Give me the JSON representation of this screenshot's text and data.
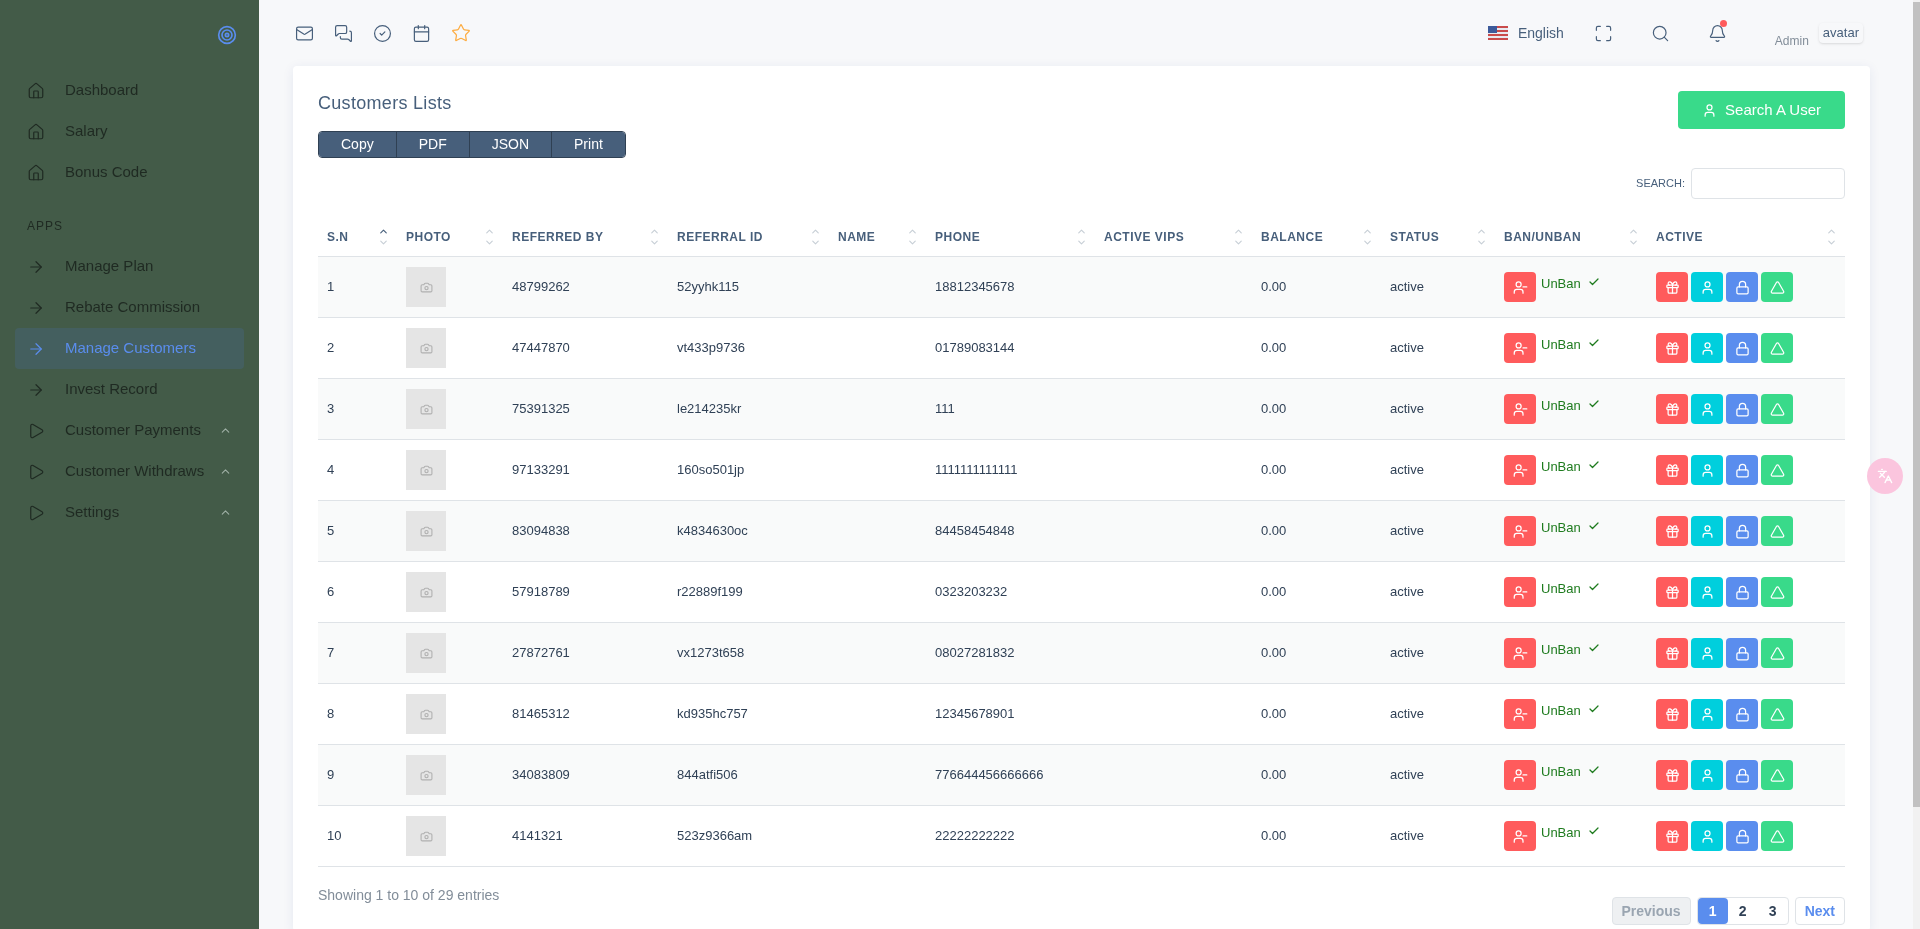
{
  "sidebar": {
    "main_items": [
      {
        "label": "Dashboard",
        "kind": "home",
        "selected": false,
        "has_submenu": false
      },
      {
        "label": "Salary",
        "kind": "home",
        "selected": false,
        "has_submenu": false
      },
      {
        "label": "Bonus Code",
        "kind": "home",
        "selected": false,
        "has_submenu": false
      }
    ],
    "section": {
      "title": "APPS",
      "items": [
        {
          "label": "Manage Plan",
          "kind": "link",
          "selected": false,
          "has_submenu": false
        },
        {
          "label": "Rebate Commission",
          "kind": "link",
          "selected": false,
          "has_submenu": false
        },
        {
          "label": "Manage Customers",
          "kind": "link",
          "selected": true,
          "has_submenu": false
        },
        {
          "label": "Invest Record",
          "kind": "link",
          "selected": false,
          "has_submenu": false
        },
        {
          "label": "Customer Payments",
          "kind": "menu",
          "selected": false,
          "has_submenu": true
        },
        {
          "label": "Customer Withdraws",
          "kind": "menu",
          "selected": false,
          "has_submenu": true
        },
        {
          "label": "Settings",
          "kind": "menu",
          "selected": false,
          "has_submenu": true
        }
      ]
    }
  },
  "topbar": {
    "language": "English",
    "notification_unread": true,
    "user": "Admin",
    "avatar_alt": "avatar"
  },
  "card": {
    "title": "Customers Lists",
    "export_buttons": [
      "Copy",
      "PDF",
      "JSON",
      "Print"
    ],
    "search_user_button": "Search A User",
    "search_label": "SEARCH:"
  },
  "table": {
    "columns": [
      {
        "label": "S.N",
        "sorted": true
      },
      {
        "label": "PHOTO",
        "sorted": false
      },
      {
        "label": "REFERRED BY",
        "sorted": false
      },
      {
        "label": "REFERRAL ID",
        "sorted": false
      },
      {
        "label": "NAME",
        "sorted": false
      },
      {
        "label": "PHONE",
        "sorted": false
      },
      {
        "label": "ACTIVE VIPS",
        "sorted": false
      },
      {
        "label": "BALANCE",
        "sorted": false
      },
      {
        "label": "STATUS",
        "sorted": false
      },
      {
        "label": "BAN/UNBAN",
        "sorted": false
      },
      {
        "label": "ACTIVE",
        "sorted": false
      }
    ],
    "rows": [
      {
        "sn": "1",
        "referred_by": "48799262",
        "referral_id": "52yyhk115",
        "phone": "18812345678",
        "balance": "0.00",
        "status": "active",
        "ban_label": "UnBan"
      },
      {
        "sn": "2",
        "referred_by": "47447870",
        "referral_id": "vt433p9736",
        "phone": "01789083144",
        "balance": "0.00",
        "status": "active",
        "ban_label": "UnBan"
      },
      {
        "sn": "3",
        "referred_by": "75391325",
        "referral_id": "le214235kr",
        "phone": "111",
        "balance": "0.00",
        "status": "active",
        "ban_label": "UnBan"
      },
      {
        "sn": "4",
        "referred_by": "97133291",
        "referral_id": "160so501jp",
        "phone": "1111111111111",
        "balance": "0.00",
        "status": "active",
        "ban_label": "UnBan"
      },
      {
        "sn": "5",
        "referred_by": "83094838",
        "referral_id": "k4834630oc",
        "phone": "84458454848",
        "balance": "0.00",
        "status": "active",
        "ban_label": "UnBan"
      },
      {
        "sn": "6",
        "referred_by": "57918789",
        "referral_id": "r22889f199",
        "phone": "0323203232",
        "balance": "0.00",
        "status": "active",
        "ban_label": "UnBan"
      },
      {
        "sn": "7",
        "referred_by": "27872761",
        "referral_id": "vx1273t658",
        "phone": "08027281832",
        "balance": "0.00",
        "status": "active",
        "ban_label": "UnBan"
      },
      {
        "sn": "8",
        "referred_by": "81465312",
        "referral_id": "kd935hc757",
        "phone": "12345678901",
        "balance": "0.00",
        "status": "active",
        "ban_label": "UnBan"
      },
      {
        "sn": "9",
        "referred_by": "34083809",
        "referral_id": "844atfi506",
        "phone": "776644456666666",
        "balance": "0.00",
        "status": "active",
        "ban_label": "UnBan"
      },
      {
        "sn": "10",
        "referred_by": "4141321",
        "referral_id": "523z9366am",
        "phone": "22222222222",
        "balance": "0.00",
        "status": "active",
        "ban_label": "UnBan"
      }
    ]
  },
  "footer": {
    "info": "Showing 1 to 10 of 29 entries",
    "previous": {
      "label": "Previous",
      "disabled": true
    },
    "pages": [
      {
        "label": "1",
        "selected": true
      },
      {
        "label": "2",
        "selected": false
      },
      {
        "label": "3",
        "selected": false
      }
    ],
    "next": {
      "label": "Next",
      "disabled": false
    }
  }
}
